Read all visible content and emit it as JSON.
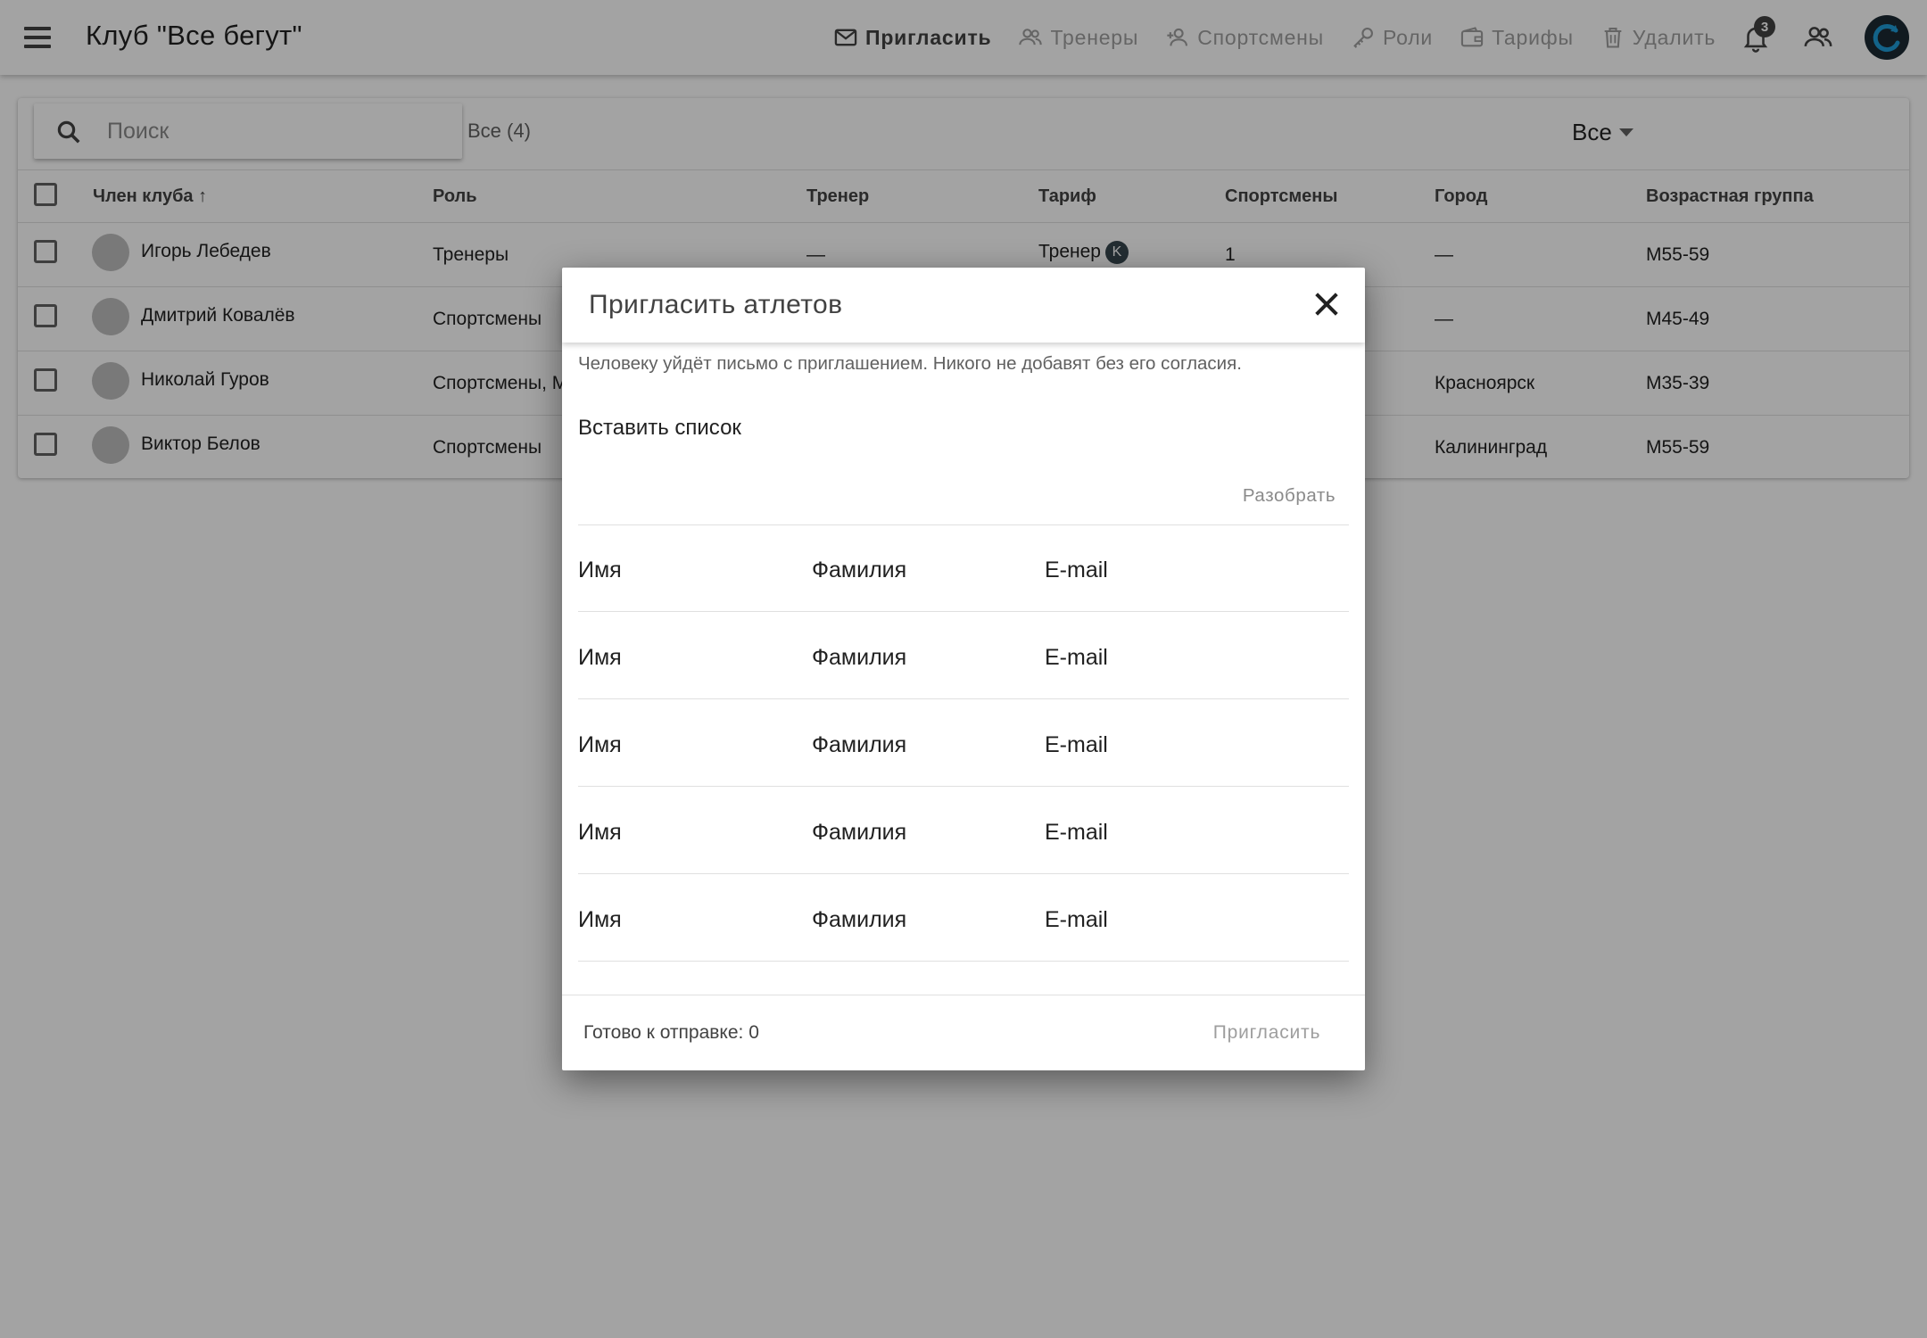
{
  "app": {
    "title": "Клуб \"Все бегут\"",
    "notifications_count": "3"
  },
  "toolbar": {
    "invite": "Пригласить",
    "coaches": "Тренеры",
    "athletes": "Спортсмены",
    "roles": "Роли",
    "tariffs": "Тарифы",
    "delete": "Удалить"
  },
  "list": {
    "search_placeholder": "Поиск",
    "count_label": "Все (4)",
    "filter_value": "Все"
  },
  "table": {
    "columns": {
      "member": "Член клуба ↑",
      "role": "Роль",
      "coach": "Тренер",
      "tariff": "Тариф",
      "athletes": "Спортсмены",
      "city": "Город",
      "age_group": "Возрастная группа"
    },
    "rows": [
      {
        "name": "Игорь Лебедев",
        "role": "Тренеры",
        "coach": "—",
        "tariff": "Тренер",
        "tariff_badge": "K",
        "athletes": "1",
        "city": "—",
        "age_group": "M55-59"
      },
      {
        "name": "Дмитрий Ковалёв",
        "role": "Спортсмены",
        "coach": "",
        "tariff": "",
        "tariff_badge": "",
        "athletes": "",
        "city": "—",
        "age_group": "M45-49"
      },
      {
        "name": "Николай Гуров",
        "role": "Спортсмены, М",
        "coach": "",
        "tariff": "",
        "tariff_badge": "",
        "athletes": "",
        "city": "Красноярск",
        "age_group": "M35-39"
      },
      {
        "name": "Виктор Белов",
        "role": "Спортсмены",
        "coach": "",
        "tariff": "",
        "tariff_badge": "",
        "athletes": "",
        "city": "Калининград",
        "age_group": "M55-59"
      }
    ]
  },
  "dialog": {
    "title": "Пригласить атлетов",
    "note": "Человеку уйдёт письмо с приглашением. Никого не добавят без его согласия.",
    "paste_label": "Вставить список",
    "parse_button": "Разобрать",
    "fields": {
      "first_name": "Имя",
      "last_name": "Фамилия",
      "email": "E-mail"
    },
    "ready_text": "Готово к отправке: 0",
    "invite_button": "Пригласить"
  },
  "colors": {
    "overlay": "#000000",
    "accent_dark": "#424242",
    "disabled": "#9e9e9e",
    "logo_bg": "#1b2a33",
    "logo_accent": "#1e9bd7"
  }
}
